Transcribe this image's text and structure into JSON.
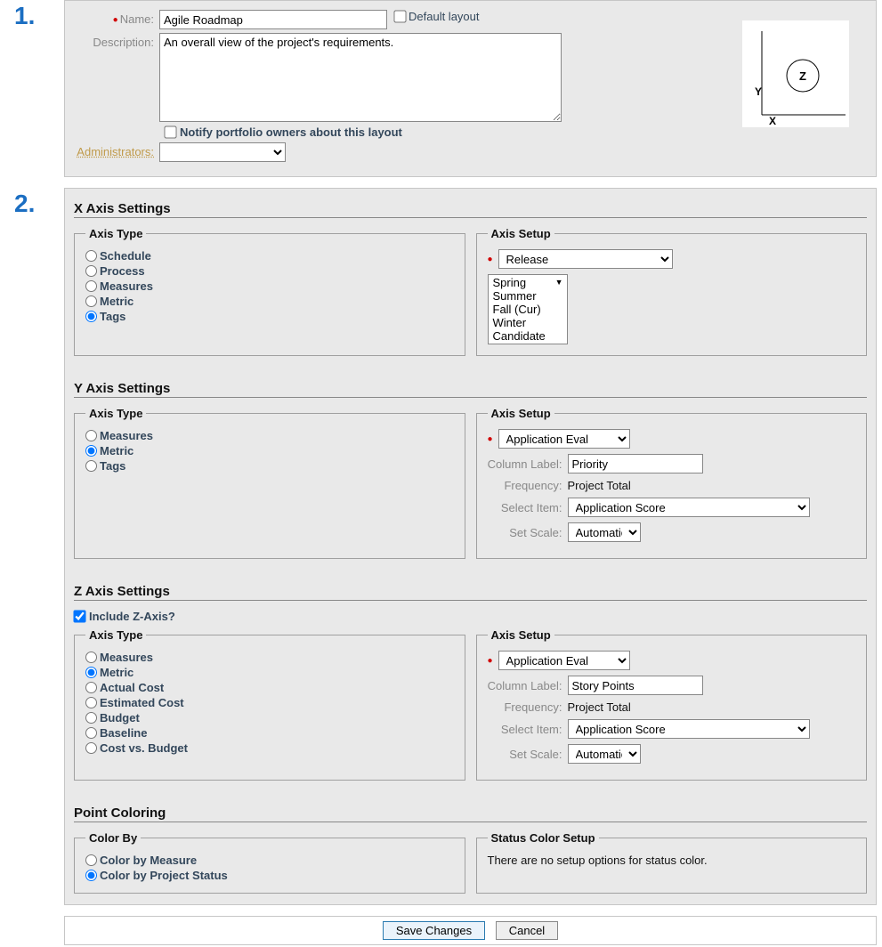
{
  "step1": {
    "number": "1.",
    "name_label": "Name:",
    "name_value": "Agile Roadmap",
    "default_layout_label": "Default layout",
    "default_layout_checked": false,
    "description_label": "Description:",
    "description_value": "An overall view of the project's requirements.",
    "notify_label": "Notify portfolio owners about this layout",
    "notify_checked": false,
    "administrators_label": "Administrators:",
    "administrators_value": "",
    "diagram": {
      "y_label": "Y",
      "x_label": "X",
      "z_label": "Z"
    }
  },
  "step2": {
    "number": "2.",
    "x_axis": {
      "heading": "X Axis Settings",
      "axis_type_legend": "Axis Type",
      "axis_type_options": [
        "Schedule",
        "Process",
        "Measures",
        "Metric",
        "Tags"
      ],
      "axis_type_selected": "Tags",
      "axis_setup_legend": "Axis Setup",
      "release_select": "Release",
      "list_items": [
        "Spring",
        "Summer",
        "Fall (Cur)",
        "Winter",
        "Candidate"
      ]
    },
    "y_axis": {
      "heading": "Y Axis Settings",
      "axis_type_legend": "Axis Type",
      "axis_type_options": [
        "Measures",
        "Metric",
        "Tags"
      ],
      "axis_type_selected": "Metric",
      "axis_setup_legend": "Axis Setup",
      "app_select": "Application Eval",
      "column_label_label": "Column Label:",
      "column_label_value": "Priority",
      "frequency_label": "Frequency:",
      "frequency_value": "Project Total",
      "select_item_label": "Select Item:",
      "select_item_value": "Application Score",
      "set_scale_label": "Set Scale:",
      "set_scale_value": "Automatic"
    },
    "z_axis": {
      "include_label": "Include Z-Axis?",
      "include_checked": true,
      "heading": "Z Axis Settings",
      "axis_type_legend": "Axis Type",
      "axis_type_options": [
        "Measures",
        "Metric",
        "Actual Cost",
        "Estimated Cost",
        "Budget",
        "Baseline",
        "Cost vs. Budget"
      ],
      "axis_type_selected": "Metric",
      "axis_setup_legend": "Axis Setup",
      "app_select": "Application Eval",
      "column_label_label": "Column Label:",
      "column_label_value": "Story Points",
      "frequency_label": "Frequency:",
      "frequency_value": "Project Total",
      "select_item_label": "Select Item:",
      "select_item_value": "Application Score",
      "set_scale_label": "Set Scale:",
      "set_scale_value": "Automatic"
    },
    "point_coloring": {
      "heading": "Point Coloring",
      "color_by_legend": "Color By",
      "color_by_options": [
        "Color by Measure",
        "Color by Project Status"
      ],
      "color_by_selected": "Color by Project Status",
      "status_setup_legend": "Status Color Setup",
      "status_setup_text": "There are no setup options for status color."
    }
  },
  "footer": {
    "save_label": "Save Changes",
    "cancel_label": "Cancel"
  }
}
